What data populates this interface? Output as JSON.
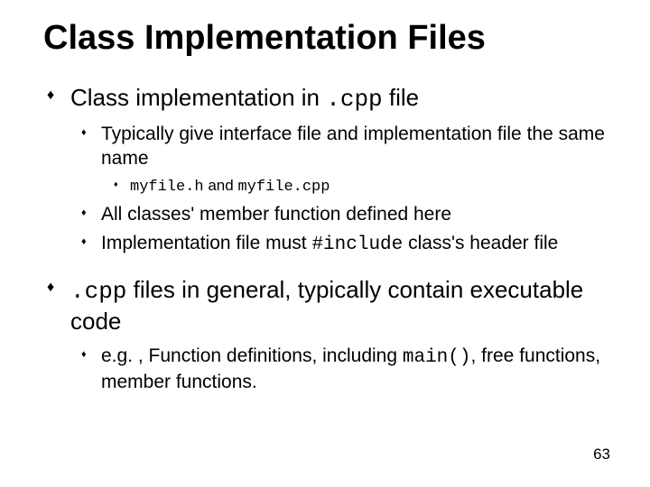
{
  "title": "Class Implementation Files",
  "b1": {
    "prefix": "Class implementation in ",
    "code": ".cpp",
    "suffix": " file",
    "sub": {
      "s1": "Typically give interface file and implementation file the same name",
      "s1sub": {
        "code1": "myfile.h",
        "mid": " and ",
        "code2": "myfile.cpp"
      },
      "s2": "All classes' member function defined here",
      "s3a": "Implementation file must ",
      "s3code": "#include",
      "s3b": " class's header file"
    }
  },
  "b2": {
    "code": ".cpp",
    "suffix": " files in general, typically contain executable code",
    "sub": {
      "s1a": "e.g. , Function definitions, including ",
      "s1code": "main()",
      "s1b": ", free functions, member functions."
    }
  },
  "page": "63"
}
